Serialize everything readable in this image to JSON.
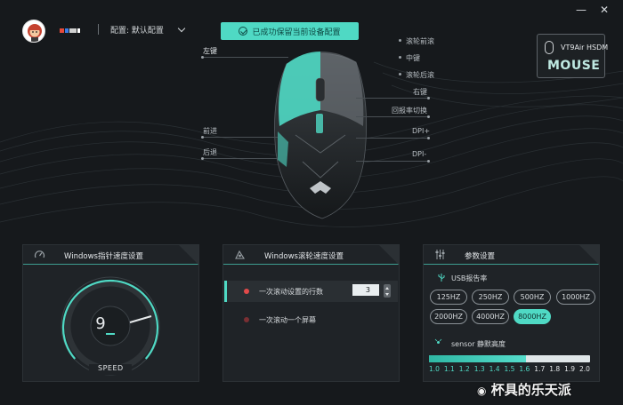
{
  "topbar": {
    "profile_label": "配置: 默认配置",
    "toast": "已成功保留当前设备配置",
    "minimize": "—",
    "close": "✕"
  },
  "device": {
    "name": "VT9Air HSDM",
    "type": "MOUSE"
  },
  "mouse_labels": {
    "left_button": "左键",
    "scroll_forward": "滚轮前滚",
    "middle": "中键",
    "scroll_back": "滚轮后滚",
    "right_button": "右键",
    "polling_switch": "回报率切换",
    "forward": "前进",
    "back": "后退",
    "dpi_plus": "DPI+",
    "dpi_minus": "DPI-"
  },
  "pointer_panel": {
    "title": "Windows指针速度设置",
    "value": "9",
    "level_fraction": 0.6,
    "speed_label": "SPEED"
  },
  "scroll_panel": {
    "title": "Windows滚轮速度设置",
    "option_lines": "一次滚动设置的行数",
    "lines_value": "3",
    "option_screen": "一次滚动一个屏幕"
  },
  "params_panel": {
    "title": "参数设置",
    "usb_label": "USB报告率",
    "rates": [
      "125HZ",
      "250HZ",
      "500HZ",
      "1000HZ",
      "2000HZ",
      "4000HZ",
      "8000HZ"
    ],
    "selected_rate": "8000HZ",
    "lod_label": "sensor 静默高度",
    "lod_ticks": [
      "1.0",
      "1.1",
      "1.2",
      "1.3",
      "1.4",
      "1.5",
      "1.6",
      "1.7",
      "1.8",
      "1.9",
      "2.0"
    ],
    "lod_value": 1.6
  },
  "watermark": "杯具的乐天派",
  "colors": {
    "accent": "#4fd9c4",
    "background": "#16191c",
    "panel": "#1f2327",
    "active_radio": "#e24a4a"
  }
}
